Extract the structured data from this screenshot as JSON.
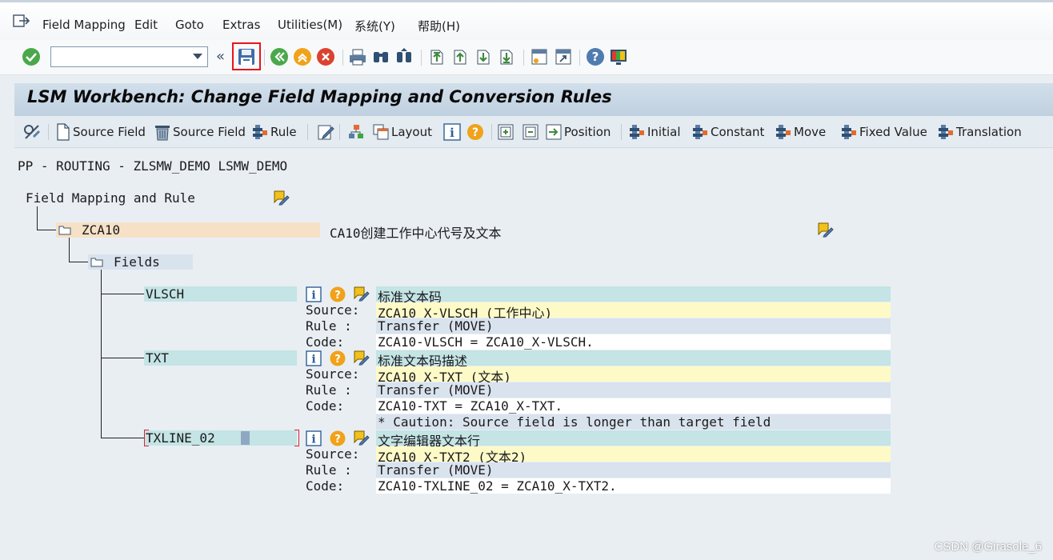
{
  "menu": {
    "field_mapping": "Field Mapping",
    "edit": "Edit",
    "goto": "Goto",
    "extras": "Extras",
    "utilities": "Utilities(M)",
    "system": "系统(Y)",
    "help": "帮助(H)"
  },
  "toolbar": {
    "command_field_value": "",
    "back_chevrons": "«"
  },
  "title": "LSM Workbench: Change Field Mapping and Conversion Rules",
  "app_toolbar": {
    "source_field_add": "Source Field",
    "source_field_delete": "Source Field",
    "rule": "Rule",
    "layout": "Layout",
    "position": "Position",
    "initial": "Initial",
    "constant": "Constant",
    "move": "Move",
    "fixed_value": "Fixed Value",
    "translation": "Translation"
  },
  "header_line": "PP - ROUTING - ZLSMW_DEMO LSMW_DEMO",
  "tree": {
    "root_label": "Field Mapping and Rule",
    "structure": {
      "name": "ZCA10",
      "description": "CA10创建工作中心代号及文本"
    },
    "fields_node": "Fields",
    "fields": [
      {
        "name": "VLSCH",
        "description": "标准文本码",
        "source_label": "Source:",
        "source": "ZCA10_X-VLSCH (工作中心)",
        "rule_label": "Rule :",
        "rule": "Transfer (MOVE)",
        "code_label": "Code:",
        "code": "ZCA10-VLSCH = ZCA10_X-VLSCH."
      },
      {
        "name": "TXT",
        "description": "标准文本码描述",
        "source_label": "Source:",
        "source": "ZCA10_X-TXT (文本)",
        "rule_label": "Rule :",
        "rule": "Transfer (MOVE)",
        "code_label": "Code:",
        "code": "ZCA10-TXT = ZCA10_X-TXT.",
        "caution": "* Caution: Source field is longer than target field"
      },
      {
        "name": "TXLINE_02",
        "description": "文字编辑器文本行",
        "source_label": "Source:",
        "source": "ZCA10_X-TXT2 (文本2)",
        "rule_label": "Rule :",
        "rule": "Transfer (MOVE)",
        "code_label": "Code:",
        "code": "ZCA10-TXLINE_02 = ZCA10_X-TXT2."
      }
    ]
  },
  "watermark": "CSDN @Girasole_6",
  "colors": {
    "title_band": "#c7d6e5",
    "structure_highlight": "#f6e1c7",
    "field_highlight": "#c4e4e6",
    "source_highlight": "#fdfac8",
    "rule_highlight": "#d9e3ee",
    "code_background": "#ffffff",
    "save_outline": "#e8151b"
  }
}
